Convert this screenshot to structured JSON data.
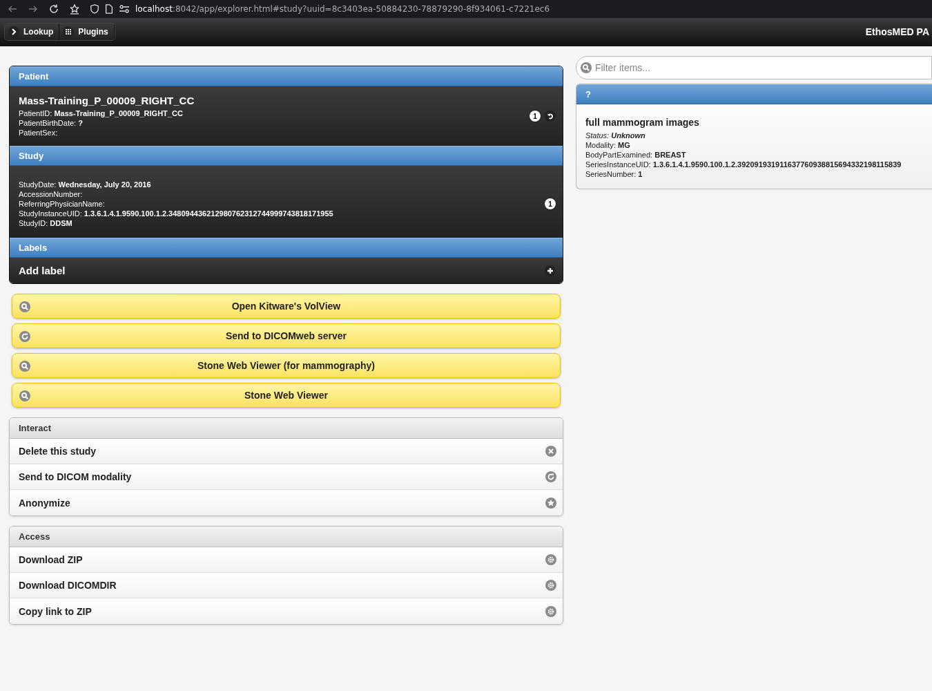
{
  "browser": {
    "url_host": "localhost",
    "url_rest": ":8042/app/explorer.html#study?uuid=8c3403ea-50884230-78879290-8f934061-c7221ec6"
  },
  "header": {
    "buttons": [
      {
        "label": "Lookup",
        "kind": "chevron"
      },
      {
        "label": "Plugins",
        "kind": "grid"
      }
    ],
    "title": "EthosMED PA"
  },
  "patient": {
    "heading": "Patient",
    "name": "Mass-Training_P_00009_RIGHT_CC",
    "count": "1",
    "fields": [
      {
        "label": "PatientID:",
        "value": "Mass-Training_P_00009_RIGHT_CC"
      },
      {
        "label": "PatientBirthDate:",
        "value": "?"
      },
      {
        "label": "PatientSex:"
      }
    ]
  },
  "study": {
    "heading": "Study",
    "count": "1",
    "fields": [
      {
        "label": "StudyDate:",
        "value": "Wednesday, July 20, 2016"
      },
      {
        "label": "AccessionNumber:"
      },
      {
        "label": "ReferringPhysicianName:"
      },
      {
        "label": "StudyInstanceUID:",
        "value": "1.3.6.1.4.1.9590.100.1.2.348094436212980762312744999743818171955"
      },
      {
        "label": "StudyID:",
        "value": "DDSM"
      }
    ]
  },
  "labels": {
    "heading": "Labels",
    "add": "Add label"
  },
  "plugins": [
    {
      "label": "Open Kitware's VolView",
      "kind": "search"
    },
    {
      "label": "Send to DICOMweb server",
      "kind": "refresh"
    },
    {
      "label": "Stone Web Viewer (for mammography)",
      "kind": "search"
    },
    {
      "label": "Stone Web Viewer",
      "kind": "search"
    }
  ],
  "interact": {
    "heading": "Interact",
    "items": [
      {
        "label": "Delete this study",
        "kind": "delete"
      },
      {
        "label": "Send to DICOM modality",
        "kind": "refresh"
      },
      {
        "label": "Anonymize",
        "kind": "star"
      }
    ]
  },
  "access": {
    "heading": "Access",
    "items": [
      {
        "label": "Download ZIP",
        "kind": "gear"
      },
      {
        "label": "Download DICOMDIR",
        "kind": "gear"
      },
      {
        "label": "Copy link to ZIP",
        "kind": "gear"
      }
    ]
  },
  "filter": {
    "placeholder": "Filter items..."
  },
  "series": {
    "heading": "?",
    "title": "full mammogram images",
    "fields": [
      {
        "label": "Status:",
        "value": "Unknown",
        "kind": "italic"
      },
      {
        "label": "Modality:",
        "value": "MG",
        "kind": "plain"
      },
      {
        "label": "BodyPartExamined:",
        "value": "BREAST",
        "kind": "plain"
      },
      {
        "label": "SeriesInstanceUID:",
        "value": "1.3.6.1.4.1.9590.100.1.2.392091931911637760938815694332198115839",
        "kind": "plain"
      },
      {
        "label": "SeriesNumber:",
        "value": "1",
        "kind": "plain"
      }
    ]
  }
}
